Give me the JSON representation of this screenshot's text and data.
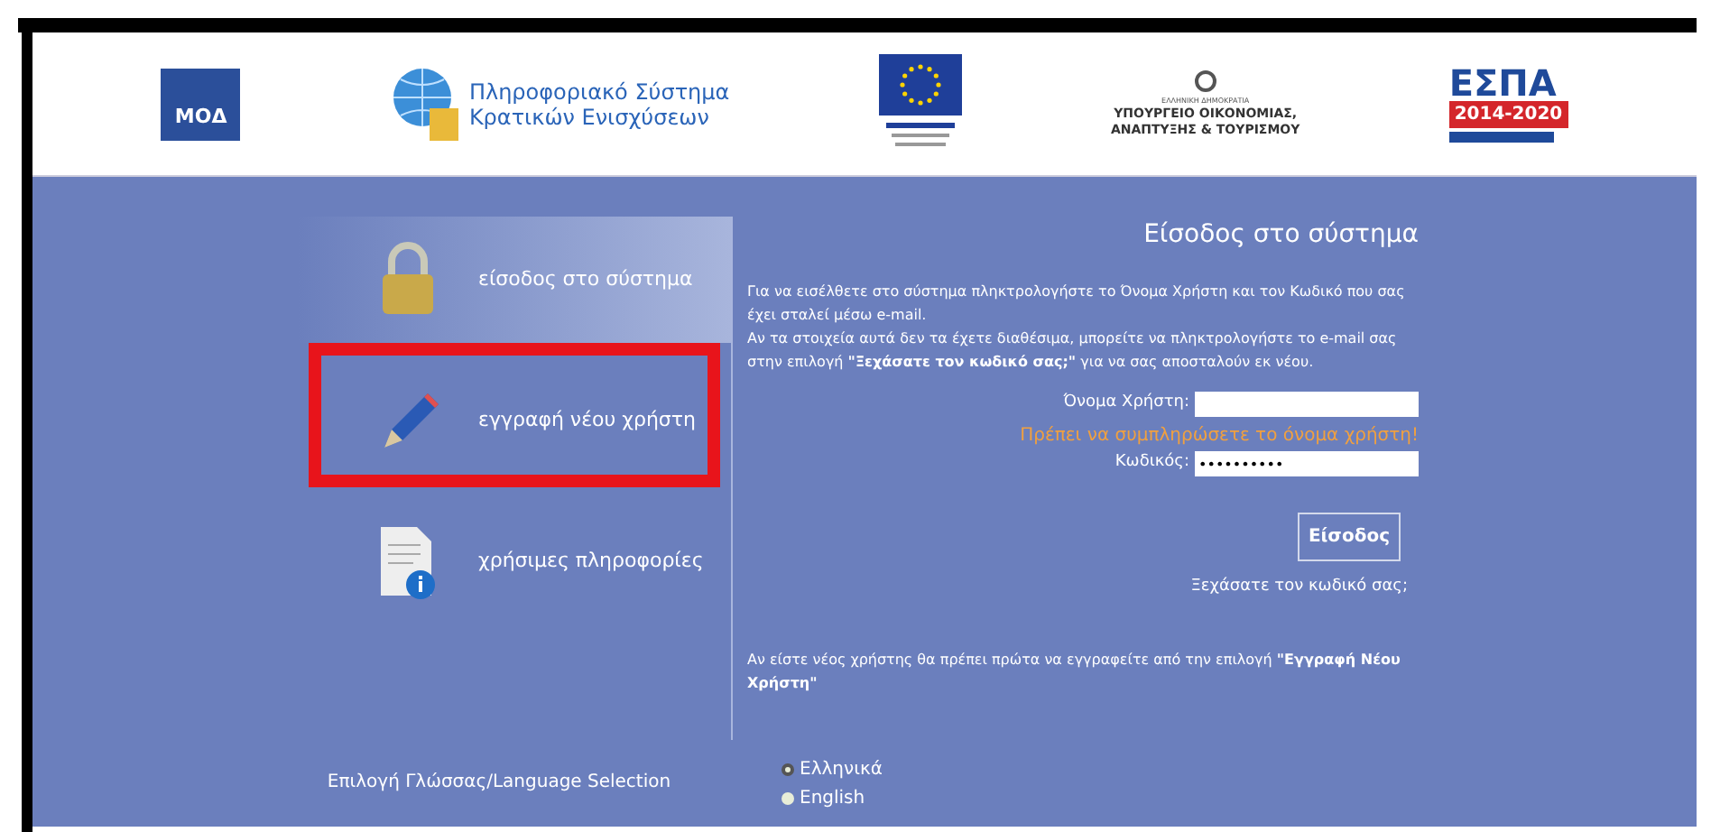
{
  "header": {
    "logos": [
      {
        "kind": "moa",
        "text": "ΜΟΔ"
      },
      {
        "kind": "system",
        "lines": [
          "Πληροφοριακό Σύστημα",
          "Κρατικών Ενισχύσεων"
        ]
      },
      {
        "kind": "eu"
      },
      {
        "kind": "ministry",
        "small": "ΕΛΛΗΝΙΚΗ ΔΗΜΟΚΡΑΤΙΑ",
        "lines": [
          "ΥΠΟΥΡΓΕΙΟ ΟΙΚΟΝΟΜΙΑΣ,",
          "ΑΝΑΠΤΥΞΗΣ & ΤΟΥΡΙΣΜΟΥ"
        ]
      },
      {
        "kind": "espa",
        "text": "ΕΣΠΑ",
        "years": "2014-2020"
      }
    ]
  },
  "sidebar": {
    "items": [
      {
        "kind": "lock",
        "label": "είσοδος στο σύστημα",
        "selected": true,
        "highlighted": false
      },
      {
        "kind": "pencil",
        "label": "εγγραφή νέου χρήστη",
        "selected": false,
        "highlighted": true
      },
      {
        "kind": "info",
        "label": "χρήσιμες πληροφορίες",
        "selected": false,
        "highlighted": false
      }
    ]
  },
  "login": {
    "title": "Είσοδος στο σύστημα",
    "intro": [
      "Για να εισέλθετε στο σύστημα πληκτρολογήστε το Όνομα Χρήστη και τον Κωδικό που σας έχει σταλεί μέσω e-mail.",
      "Αν τα στοιχεία αυτά δεν τα έχετε διαθέσιμα, μπορείτε να πληκτρολογήστε το e-mail σας στην επιλογή **\"Ξεχάσατε τον κωδικό σας;\"** για να σας αποσταλούν εκ νέου."
    ],
    "username_label": "Όνομα Χρήστη:",
    "error": "Πρέπει να συμπληρώσετε το όνομα χρήστη!",
    "password_label": "Κωδικός:",
    "password_value": "••••••••••",
    "submit": "Είσοδος",
    "forgot": "Ξεχάσατε τον κωδικό σας;",
    "register_note": "Αν είστε νέος χρήστης θα πρέπει πρώτα να εγγραφείτε από την επιλογή **\"Εγγραφή Νέου Χρήστη\"**"
  },
  "language": {
    "label": "Επιλογή Γλώσσας/Language Selection",
    "options": [
      {
        "label": "Ελληνικά",
        "selected": true
      },
      {
        "label": "English",
        "selected": false
      }
    ]
  }
}
